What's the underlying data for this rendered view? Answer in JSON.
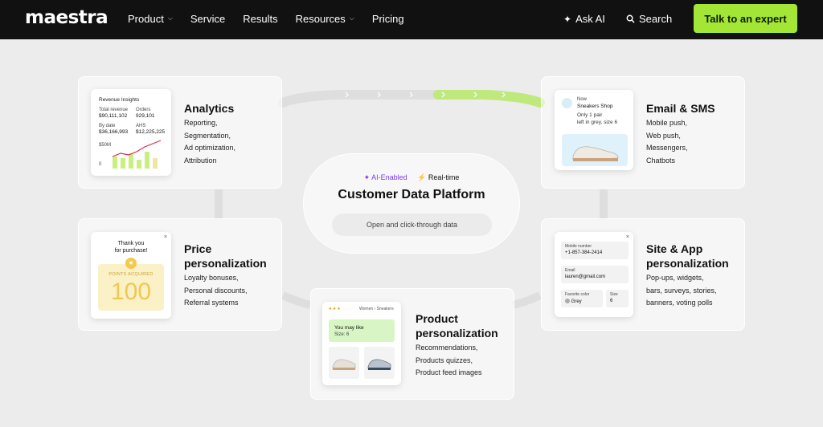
{
  "nav": {
    "logo": "maestra",
    "items": [
      {
        "label": "Product",
        "has_menu": true
      },
      {
        "label": "Service",
        "has_menu": false
      },
      {
        "label": "Results",
        "has_menu": false
      },
      {
        "label": "Resources",
        "has_menu": true
      },
      {
        "label": "Pricing",
        "has_menu": false
      }
    ],
    "ask_ai": "Ask AI",
    "search": "Search",
    "cta": "Talk to an expert"
  },
  "center": {
    "ai_badge": "AI-Enabled",
    "realtime_badge": "Real-time",
    "title": "Customer Data Platform",
    "button": "Open and click-through data"
  },
  "analytics": {
    "title": "Analytics",
    "items": [
      "Reporting,",
      "Segmentation,",
      "Ad optimization,",
      "Attribution"
    ],
    "widget": {
      "title": "Revenue Insights",
      "m1_label": "Total revenue",
      "m1_value": "$90,111,102",
      "m2_label": "Orders",
      "m2_value": "929,101",
      "m3_label": "By date",
      "m3_value": "$36,166,993",
      "m4_label": "AHS",
      "m4_value": "$12,225,225",
      "y_top": "$50M",
      "y_bottom": "0"
    }
  },
  "email": {
    "title": "Email & SMS",
    "items": [
      "Mobile push,",
      "Web push,",
      "Messengers,",
      "Chatbots"
    ],
    "widget": {
      "small": "Now",
      "store": "Sneakers Shop",
      "msg1": "Only 1 pair",
      "msg2": "left in grey, size 6"
    }
  },
  "price": {
    "title_line1": "Price",
    "title_line2": "personalization",
    "items": [
      "Loyalty bonuses,",
      "Personal discounts,",
      "Referral systems"
    ],
    "widget": {
      "thanks1": "Thank you",
      "thanks2": "for purchase!",
      "points_label": "POINTS ACQUIRED",
      "points": "100",
      "close": "×"
    }
  },
  "site": {
    "title_line1": "Site & App",
    "title_line2": "personalization",
    "items": [
      "Pop-ups, widgets,",
      "bars, surveys, stories,",
      "banners, voting polls"
    ],
    "widget": {
      "phone_label": "Mobile number",
      "phone": "+1-857-384-2414",
      "email_label": "Email",
      "email": "lauren@gmail.com",
      "color_label": "Favorite color",
      "color": "Grey",
      "size_label": "Size",
      "size": "6",
      "close": "×"
    }
  },
  "product": {
    "title_line1": "Product",
    "title_line2": "personalization",
    "items": [
      "Recommendations,",
      "Products quizzes,",
      "Product feed images"
    ],
    "widget": {
      "crumb1": "Women",
      "crumb2": "Sneakers",
      "may_like": "You may like",
      "size": "Size: 6"
    }
  },
  "colors": {
    "accent": "#a3e635",
    "ai": "#7c3aed",
    "chart_bar": "#b7ea6a",
    "chart_line": "#e0294a",
    "points_bg": "#fbf1c7",
    "points_text": "#f2c94c"
  }
}
